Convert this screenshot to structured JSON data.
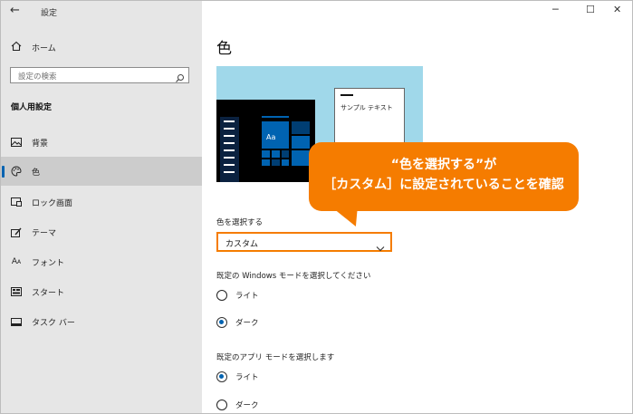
{
  "window": {
    "back_glyph": "←",
    "title": "設定",
    "minimize_glyph": "─",
    "maximize_glyph": "☐",
    "close_glyph": "✕"
  },
  "sidebar": {
    "home_label": "ホーム",
    "search_placeholder": "設定の検索",
    "section_title": "個人用設定",
    "items": [
      {
        "label": "背景",
        "icon": "image-icon"
      },
      {
        "label": "色",
        "icon": "palette-icon",
        "active": true
      },
      {
        "label": "ロック画面",
        "icon": "lock-screen-icon"
      },
      {
        "label": "テーマ",
        "icon": "theme-icon"
      },
      {
        "label": "フォント",
        "icon": "font-icon"
      },
      {
        "label": "スタート",
        "icon": "start-icon"
      },
      {
        "label": "タスク バー",
        "icon": "taskbar-icon"
      }
    ]
  },
  "main": {
    "title": "色",
    "preview": {
      "tile_text": "Aa",
      "sample_text": "サンプル テキスト"
    },
    "callout": {
      "line1": "“色を選択する”が",
      "line2": "［カスタム］に設定されていることを確認"
    },
    "color_select": {
      "label": "色を選択する",
      "value": "カスタム"
    },
    "windows_mode": {
      "label": "既定の Windows モードを選択してください",
      "options": [
        {
          "label": "ライト",
          "selected": false
        },
        {
          "label": "ダーク",
          "selected": true
        }
      ]
    },
    "app_mode": {
      "label": "既定のアプリ モードを選択します",
      "options": [
        {
          "label": "ライト",
          "selected": true
        },
        {
          "label": "ダーク",
          "selected": false
        }
      ]
    }
  },
  "colors": {
    "accent": "#0063b1",
    "callout": "#f57c00",
    "preview_bg": "#a0d8ea"
  }
}
